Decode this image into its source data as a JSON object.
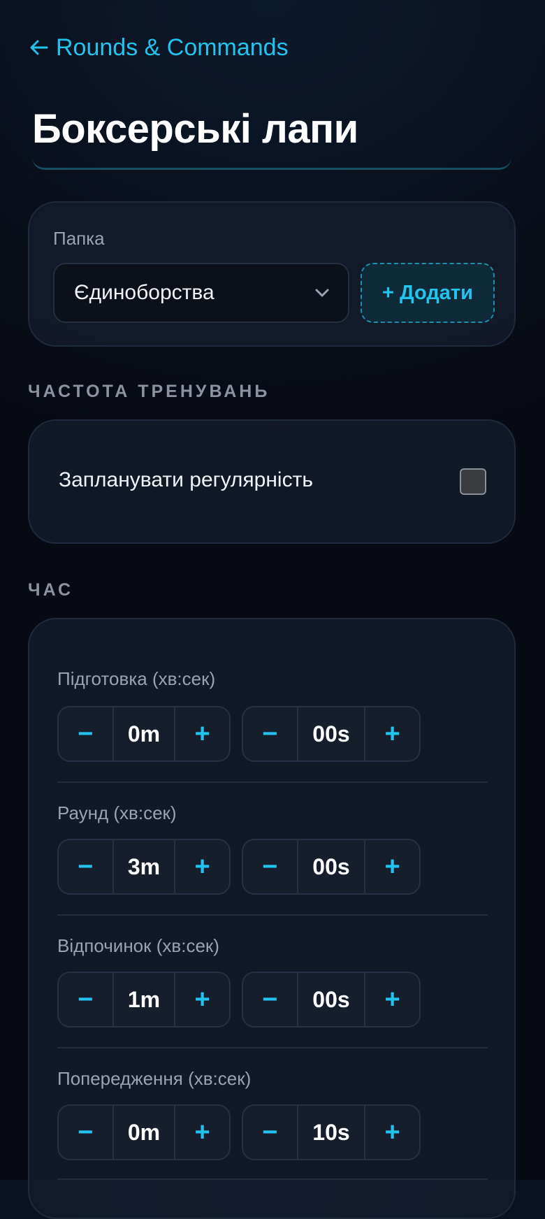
{
  "nav": {
    "back_label": "Rounds & Commands"
  },
  "page": {
    "title": "Боксерські лапи"
  },
  "folder": {
    "label": "Папка",
    "selected": "Єдиноборства",
    "add_label": "+ Додати"
  },
  "frequency": {
    "section_title": "ЧАСТОТА ТРЕНУВАНЬ",
    "schedule_label": "Запланувати регулярність",
    "schedule_checked": false
  },
  "time": {
    "section_title": "ЧАС",
    "minus": "−",
    "plus": "+",
    "rows": [
      {
        "label": "Підготовка (хв:сек)",
        "minutes": "0m",
        "seconds": "00s"
      },
      {
        "label": "Раунд (хв:сек)",
        "minutes": "3m",
        "seconds": "00s"
      },
      {
        "label": "Відпочинок (хв:сек)",
        "minutes": "1m",
        "seconds": "00s"
      },
      {
        "label": "Попередження (хв:сек)",
        "minutes": "0m",
        "seconds": "10s"
      }
    ]
  },
  "colors": {
    "accent": "#22c3ee",
    "background": "#080c16",
    "card": "#161e2e",
    "muted_text": "#9aa3b2"
  },
  "icons": {
    "back": "arrow-left-icon",
    "select": "chevron-down-icon"
  }
}
